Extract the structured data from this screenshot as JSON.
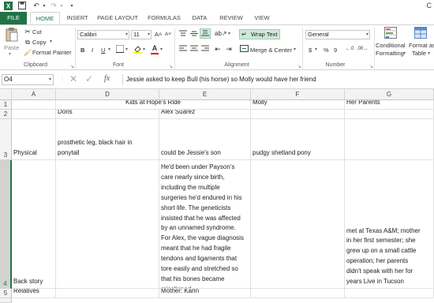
{
  "title_bar": {
    "title_fragment": "C"
  },
  "ribbon_tabs": [
    "FILE",
    "HOME",
    "INSERT",
    "PAGE LAYOUT",
    "FORMULAS",
    "DATA",
    "REVIEW",
    "VIEW"
  ],
  "clipboard": {
    "paste": "Paste",
    "cut": "Cut",
    "copy": "Copy",
    "format_painter": "Format Painter",
    "label": "Clipboard"
  },
  "font": {
    "name": "Calibri",
    "size": "11",
    "grow": "A˄",
    "shrink": "A˅",
    "bold": "B",
    "italic": "I",
    "underline": "U",
    "label": "Font"
  },
  "alignment": {
    "wrap_text": "Wrap Text",
    "merge_center": "Merge & Center",
    "label": "Alignment"
  },
  "number": {
    "format": "General",
    "currency": "$",
    "percent": "%",
    "comma": "9",
    "label": "Number"
  },
  "styles": {
    "conditional": "Conditional",
    "conditional2": "Formatting",
    "format_as": "Format as",
    "format_as2": "Table"
  },
  "formula_bar": {
    "name_box": "O4",
    "fx": "fx",
    "content": "Jessie asked to keep Bull (his horse) so Molly would have her friend"
  },
  "columns": [
    "A",
    "D",
    "E",
    "F",
    "G"
  ],
  "rows": [
    "1",
    "2",
    "3",
    "4",
    "5"
  ],
  "cells": {
    "D1": "Kids at Hope's Ride",
    "F1": "Molly",
    "G1": "Her Parents",
    "D2": "Doris",
    "E2": "Alex Suarez",
    "A3": "Physical",
    "D3_line1": "prosthetic leg, black hair in",
    "D3_line2": "ponytail",
    "E3": "could be Jessie's son",
    "F3": "pudgy shetland pony",
    "A4": "Back story",
    "E4_lines": [
      "He'd been under Payson's",
      "care nearly since birth,",
      "including the multiple",
      "surgeries he'd endured in his",
      "short life. The geneticists",
      "insisted that he was affected",
      "by an unnamed syndrome.",
      "For Alex, the vague diagnosis",
      "meant that he had fragile",
      "tendons and ligaments that",
      "tore easily and stretched so",
      "that his bones became",
      "misaligned"
    ],
    "G4_lines": [
      "met at Texas A&M; mother",
      "in her first semester; she",
      "grew up on a small cattle",
      "operation; her parents",
      "didn't speak with her for",
      "years Live in Tucson"
    ],
    "A5": "Relatives",
    "E5": "Mother: Karin"
  }
}
